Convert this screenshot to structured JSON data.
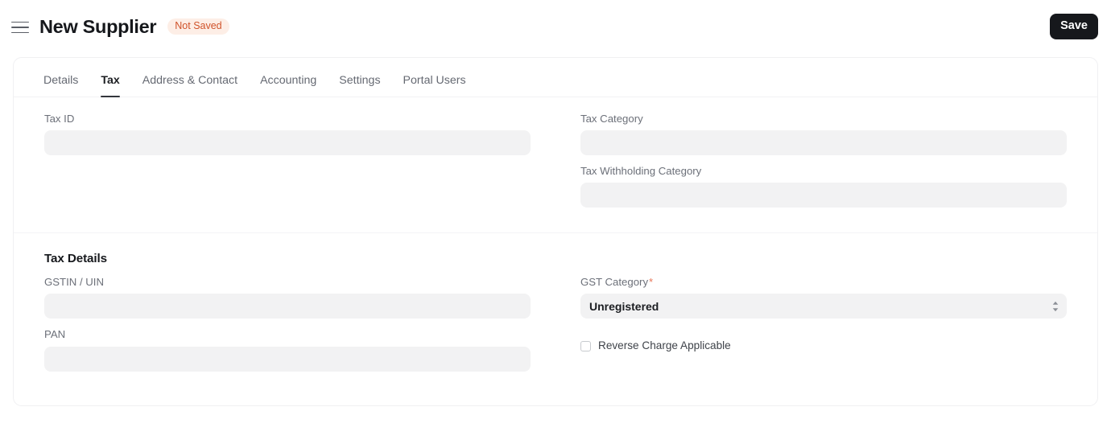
{
  "header": {
    "menu_icon": "hamburger-icon",
    "title": "New Supplier",
    "status_badge": "Not Saved",
    "save_label": "Save",
    "badge_bg": "#fdeee6",
    "badge_color": "#d0532a",
    "save_bg": "#16181c"
  },
  "tabs": [
    {
      "label": "Details",
      "active": false
    },
    {
      "label": "Tax",
      "active": true
    },
    {
      "label": "Address & Contact",
      "active": false
    },
    {
      "label": "Accounting",
      "active": false
    },
    {
      "label": "Settings",
      "active": false
    },
    {
      "label": "Portal Users",
      "active": false
    }
  ],
  "sections": [
    {
      "title": "",
      "left_fields": [
        {
          "label": "Tax ID",
          "value": "",
          "placeholder": "",
          "required": false,
          "type": "text"
        }
      ],
      "right_fields": [
        {
          "label": "Tax Category",
          "value": "",
          "placeholder": "",
          "required": false,
          "type": "text"
        },
        {
          "label": "Tax Withholding Category",
          "value": "",
          "placeholder": "",
          "required": false,
          "type": "text"
        }
      ]
    },
    {
      "title": "Tax Details",
      "left_fields": [
        {
          "label": "GSTIN / UIN",
          "value": "",
          "placeholder": "",
          "required": false,
          "type": "text"
        },
        {
          "label": "PAN",
          "value": "",
          "placeholder": "",
          "required": false,
          "type": "text"
        }
      ],
      "right_fields": [
        {
          "label": "GST Category",
          "value": "Unregistered",
          "placeholder": "",
          "required": true,
          "type": "select"
        }
      ],
      "checkbox": {
        "label": "Reverse Charge Applicable",
        "checked": false
      }
    }
  ],
  "labels": {
    "tax_id": "Tax ID",
    "tax_category": "Tax Category",
    "tax_withholding_category": "Tax Withholding Category",
    "tax_details": "Tax Details",
    "gstin_uin": "GSTIN / UIN",
    "pan": "PAN",
    "gst_category": "GST Category",
    "gst_category_value": "Unregistered",
    "reverse_charge": "Reverse Charge Applicable",
    "required_mark": "*"
  }
}
